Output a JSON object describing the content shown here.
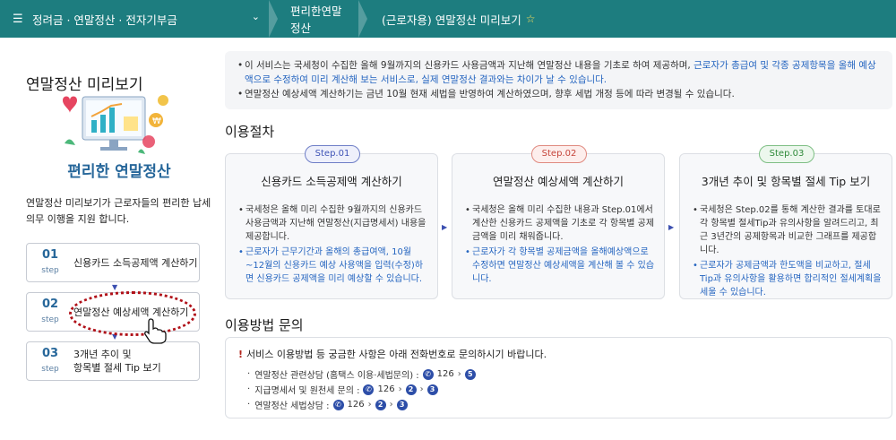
{
  "topnav": {
    "menu_label": "정려금 · 연말정산 · 전자기부금",
    "crumb1": "편리한연말정산",
    "crumb2": "(근로자용) 연말정산 미리보기"
  },
  "sidebar": {
    "title": "연말정산 미리보기",
    "subtitle": "편리한 연말정산",
    "description": "연말정산 미리보기가 근로자들의 편리한 납세 의무 이행을 지원 합니다.",
    "steps": [
      {
        "num": "01",
        "unit": "step",
        "label": "신용카드 소득공제액 계산하기"
      },
      {
        "num": "02",
        "unit": "step",
        "label": "연말정산 예상세액 계산하기"
      },
      {
        "num": "03",
        "unit": "step",
        "label_line1": "3개년 추이 및",
        "label_line2": "항목별 절세 Tip 보기"
      }
    ]
  },
  "notice": {
    "line1_a": "이 서비스는 국세청이 수집한 올해 9월까지의 신용카드 사용금액과 지난해 연말정산 내용을 기초로 하여 제공하며, ",
    "line1_b": "근로자가 총급여 및 각종 공제항목을 올해 예상액으로 수정하여 미리 계산해 보는 서비스로, 실제 연말정산 결과와는 차이가 날 수 있습니다.",
    "line2": "연말정산 예상세액 계산하기는 금년 10월 현재 세법을 반영하여 계산하였으며, 향후 세법 개정 등에 따라 변경될 수 있습니다."
  },
  "procedure": {
    "title": "이용절차",
    "cards": [
      {
        "step": "Step.01",
        "title": "신용카드 소득공제액 계산하기",
        "body": "국세청은 올해 미리 수집한 9월까지의 신용카드 사용금액과 지난해 연말정산(지급명세서) 내용을 제공합니다.",
        "note": "근로자가 근무기간과 올해의 총급여액, 10월~12월의 신용카드 예상 사용액을 입력(수정)하면 신용카드 공제액을 미리 예상할 수 있습니다."
      },
      {
        "step": "Step.02",
        "title": "연말정산 예상세액 계산하기",
        "body": "국세청은 올해 미리 수집한 내용과 Step.01에서 계산한 신용카드 공제액을 기초로 각 항목별 공제금액을 미리 채워줍니다.",
        "note": "근로자가 각 항목별 공제금액을 올해예상액으로 수정하면 연말정산 예상세액을 계산해 볼 수 있습니다."
      },
      {
        "step": "Step.03",
        "title": "3개년 추이 및 항목별 절세 Tip 보기",
        "body": "국세청은 Step.02를 통해 계산한 결과를 토대로 각 항목별 절세Tip과 유의사항을 알려드리고, 최근 3년간의 공제항목과 비교한 그래프를 제공합니다.",
        "note": "근로자가 공제금액과 한도액을 비교하고, 절세Tip과 유의사항을 활용하면 합리적인 절세계획을 세울 수 있습니다."
      }
    ]
  },
  "inquiry": {
    "title": "이용방법 문의",
    "head": "서비스 이용방법 등 궁금한 사항은 아래 전화번호로 문의하시기 바랍니다.",
    "rows": [
      {
        "label": "연말정산 관련상담 (홈택스 이용·세법문의) :",
        "number": "126",
        "opts": [
          "5"
        ]
      },
      {
        "label": "지급명세서 및 원천세 문의 :",
        "number": "126",
        "opts": [
          "2",
          "3"
        ]
      },
      {
        "label": "연말정산 세법상담 :",
        "number": "126",
        "opts": [
          "2",
          "3"
        ]
      }
    ]
  }
}
